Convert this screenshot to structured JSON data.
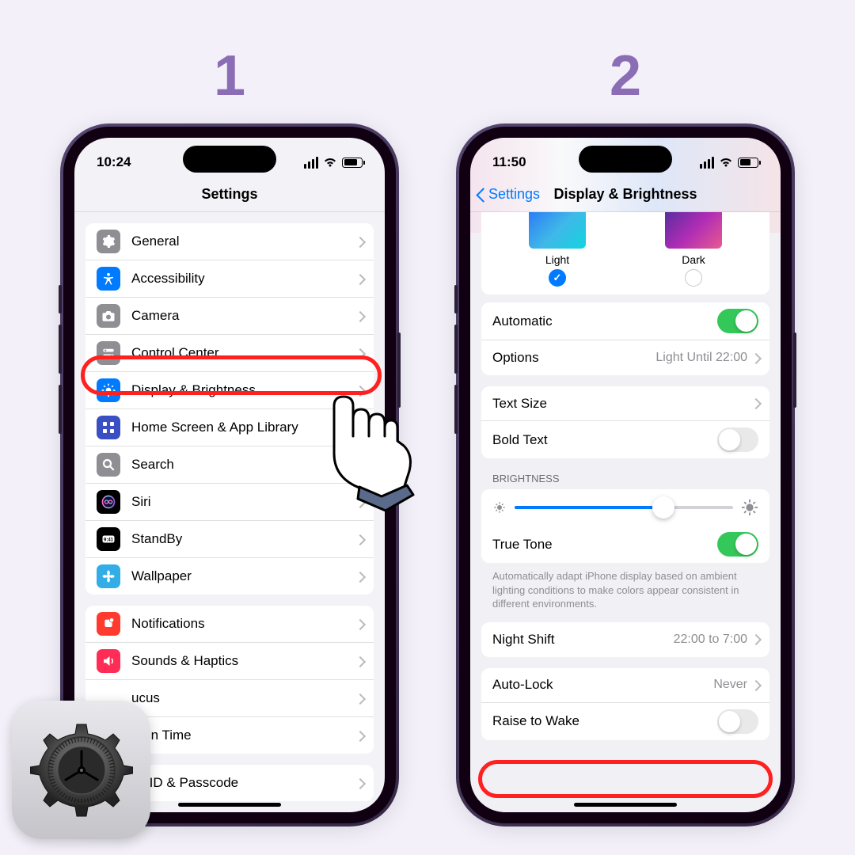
{
  "steps": {
    "one": "1",
    "two": "2"
  },
  "phone1": {
    "time": "10:24",
    "title": "Settings",
    "groups": [
      [
        {
          "name": "general",
          "label": "General",
          "icon": "gear",
          "color": "ic-gray"
        },
        {
          "name": "accessibility",
          "label": "Accessibility",
          "icon": "person",
          "color": "ic-blue"
        },
        {
          "name": "camera",
          "label": "Camera",
          "icon": "camera",
          "color": "ic-gray"
        },
        {
          "name": "control-center",
          "label": "Control Center",
          "icon": "switches",
          "color": "ic-gray"
        },
        {
          "name": "display-brightness",
          "label": "Display & Brightness",
          "icon": "sun",
          "color": "ic-blue",
          "highlight": true
        },
        {
          "name": "home-screen",
          "label": "Home Screen & App Library",
          "icon": "grid",
          "color": "ic-blue"
        },
        {
          "name": "search",
          "label": "Search",
          "icon": "magnify",
          "color": "ic-gray"
        },
        {
          "name": "siri",
          "label": "Siri",
          "icon": "siri",
          "color": "ic-black"
        },
        {
          "name": "standby",
          "label": "StandBy",
          "icon": "clock",
          "color": "ic-black"
        },
        {
          "name": "wallpaper",
          "label": "Wallpaper",
          "icon": "flower",
          "color": "ic-cyan"
        }
      ],
      [
        {
          "name": "notifications",
          "label": "Notifications",
          "icon": "bell",
          "color": "ic-red"
        },
        {
          "name": "sounds-haptics",
          "label": "Sounds & Haptics",
          "icon": "speaker",
          "color": "ic-pink"
        },
        {
          "name": "focus",
          "label": "Focus",
          "icon": "moon",
          "color": "ic-indigo",
          "cut": "ucus"
        },
        {
          "name": "screen-time",
          "label": "Screen Time",
          "icon": "hourglass",
          "color": "ic-indigo",
          "cut": "reen Time"
        }
      ],
      [
        {
          "name": "faceid",
          "label": "Face ID & Passcode",
          "icon": "faceid",
          "color": "ic-green",
          "cut": "ce ID & Passcode"
        }
      ]
    ]
  },
  "phone2": {
    "time": "11:50",
    "back_label": "Settings",
    "title": "Display & Brightness",
    "appearance": {
      "light": "Light",
      "dark": "Dark"
    },
    "rows": {
      "automatic": "Automatic",
      "options": {
        "label": "Options",
        "detail": "Light Until 22:00"
      },
      "text_size": "Text Size",
      "bold_text": "Bold Text",
      "brightness_header": "BRIGHTNESS",
      "true_tone": "True Tone",
      "true_tone_footer": "Automatically adapt iPhone display based on ambient lighting conditions to make colors appear consistent in different environments.",
      "night_shift": {
        "label": "Night Shift",
        "detail": "22:00 to 7:00"
      },
      "auto_lock": {
        "label": "Auto-Lock",
        "detail": "Never"
      },
      "raise_to_wake": "Raise to Wake"
    }
  }
}
